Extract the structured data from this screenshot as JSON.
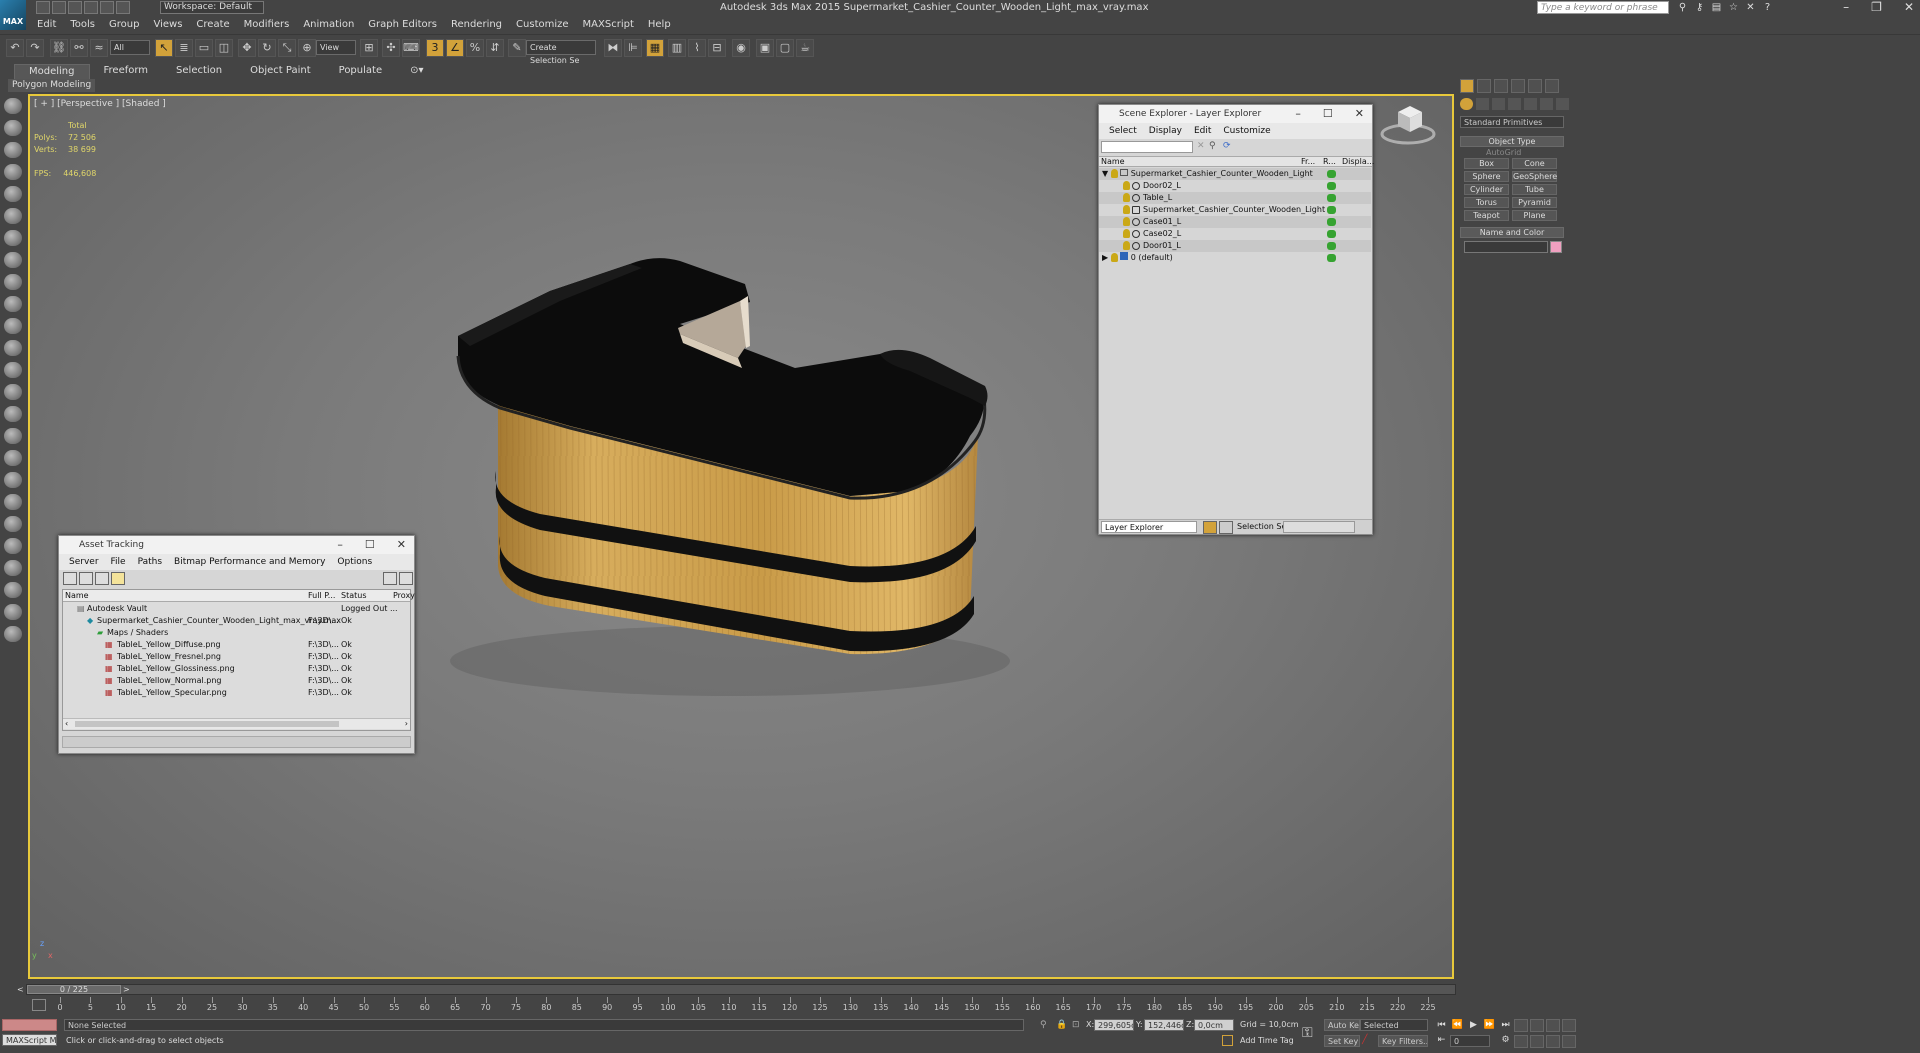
{
  "app": {
    "title": "Autodesk 3ds Max  2015     Supermarket_Cashier_Counter_Wooden_Light_max_vray.max",
    "workspace": "Workspace: Default",
    "logo": "MAX",
    "search_placeholder": "Type a keyword or phrase"
  },
  "menu": [
    "Edit",
    "Tools",
    "Group",
    "Views",
    "Create",
    "Modifiers",
    "Animation",
    "Graph Editors",
    "Rendering",
    "Customize",
    "MAXScript",
    "Help"
  ],
  "toolbar": {
    "selection_filter": "All",
    "ref_coord": "View",
    "named_selection": "Create Selection Se"
  },
  "ribbon": {
    "tabs": [
      "Modeling",
      "Freeform",
      "Selection",
      "Object Paint",
      "Populate"
    ],
    "active": "Modeling",
    "sub_label": "Polygon Modeling"
  },
  "viewport": {
    "label": "[ + ] [Perspective ] [Shaded ]",
    "stats_header": "Total",
    "polys_label": "Polys:",
    "polys": "72 506",
    "verts_label": "Verts:",
    "verts": "38 699",
    "fps_label": "FPS:",
    "fps": "446,608",
    "axis_x": "x",
    "axis_y": "y",
    "axis_z": "z"
  },
  "scene_explorer": {
    "title": "Scene Explorer - Layer Explorer",
    "menu": [
      "Select",
      "Display",
      "Edit",
      "Customize"
    ],
    "columns": [
      "Name",
      "Fr...",
      "R...",
      "Displa..."
    ],
    "rows": [
      {
        "name": "Supermarket_Cashier_Counter_Wooden_Light",
        "level": 0
      },
      {
        "name": "Door02_L",
        "level": 1
      },
      {
        "name": "Table_L",
        "level": 1
      },
      {
        "name": "Supermarket_Cashier_Counter_Wooden_Light",
        "level": 1
      },
      {
        "name": "Case01_L",
        "level": 1
      },
      {
        "name": "Case02_L",
        "level": 1
      },
      {
        "name": "Door01_L",
        "level": 1
      },
      {
        "name": "0 (default)",
        "level": 0
      }
    ],
    "footer_combo": "Layer Explorer",
    "selection_set_label": "Selection Set:"
  },
  "asset_tracking": {
    "title": "Asset Tracking",
    "menu": [
      "Server",
      "File",
      "Paths",
      "Bitmap Performance and Memory",
      "Options"
    ],
    "columns": [
      "Name",
      "Full P...",
      "Status",
      "Proxy"
    ],
    "rows": [
      {
        "name": "Autodesk Vault",
        "path": "",
        "status": "Logged Out ..."
      },
      {
        "name": "Supermarket_Cashier_Counter_Wooden_Light_max_vray.max",
        "path": "F:\\3D\\...",
        "status": "Ok"
      },
      {
        "name": "Maps / Shaders",
        "path": "",
        "status": ""
      },
      {
        "name": "TableL_Yellow_Diffuse.png",
        "path": "F:\\3D\\...",
        "status": "Ok"
      },
      {
        "name": "TableL_Yellow_Fresnel.png",
        "path": "F:\\3D\\...",
        "status": "Ok"
      },
      {
        "name": "TableL_Yellow_Glossiness.png",
        "path": "F:\\3D\\...",
        "status": "Ok"
      },
      {
        "name": "TableL_Yellow_Normal.png",
        "path": "F:\\3D\\...",
        "status": "Ok"
      },
      {
        "name": "TableL_Yellow_Specular.png",
        "path": "F:\\3D\\...",
        "status": "Ok"
      }
    ]
  },
  "command_panel": {
    "category": "Standard Primitives",
    "object_type_label": "Object Type",
    "autogrid": "AutoGrid",
    "buttons": [
      "Box",
      "Cone",
      "Sphere",
      "GeoSphere",
      "Cylinder",
      "Tube",
      "Torus",
      "Pyramid",
      "Teapot",
      "Plane"
    ],
    "name_color_label": "Name and Color"
  },
  "timeline": {
    "frame_display": "0 / 225",
    "ticks": [
      "0",
      "5",
      "10",
      "15",
      "20",
      "25",
      "30",
      "35",
      "40",
      "45",
      "50",
      "55",
      "60",
      "65",
      "70",
      "75",
      "80",
      "85",
      "90",
      "95",
      "100",
      "105",
      "110",
      "115",
      "120",
      "125",
      "130",
      "135",
      "140",
      "145",
      "150",
      "155",
      "160",
      "165",
      "170",
      "175",
      "180",
      "185",
      "190",
      "195",
      "200",
      "205",
      "210",
      "215",
      "220",
      "225"
    ]
  },
  "status": {
    "maxscript": "MAXScript Mi:",
    "selection": "None Selected",
    "prompt": "Click or click-and-drag to select objects",
    "x_label": "X:",
    "x": "299,605cm",
    "y_label": "Y:",
    "y": "152,446cm",
    "z_label": "Z:",
    "z": "0,0cm",
    "grid": "Grid = 10,0cm",
    "add_time_tag": "Add Time Tag",
    "auto_key": "Auto Key",
    "set_key": "Set Key",
    "key_mode": "Selected",
    "key_filters": "Key Filters...",
    "frame": "0"
  }
}
